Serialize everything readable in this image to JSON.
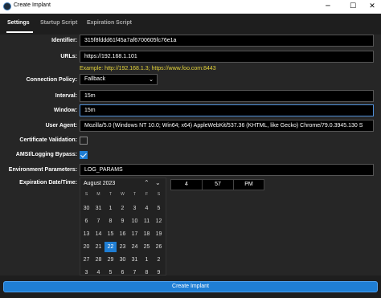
{
  "window": {
    "title": "Create Implant",
    "minimize": "─",
    "maximize": "☐",
    "close": "✕"
  },
  "tabs": [
    "Settings",
    "Startup Script",
    "Expiration Script"
  ],
  "fields": {
    "identifier": {
      "label": "Identifier:",
      "value": "315f8fddd61f45a7af6700605fc76e1a"
    },
    "urls": {
      "label": "URLs:",
      "value": "https://192.168.1.101",
      "hint": "Example: http://192.168.1.3; https://www.foo.com:8443"
    },
    "connection_policy": {
      "label": "Connection Policy:",
      "value": "Fallback"
    },
    "interval": {
      "label": "Interval:",
      "value": "15m"
    },
    "window": {
      "label": "Window:",
      "value": "15m"
    },
    "user_agent": {
      "label": "User Agent:",
      "value": "Mozilla/5.0 (Windows NT 10.0; Win64; x64) AppleWebKit/537.36 (KHTML, like Gecko) Chrome/79.0.3945.130 S"
    },
    "certificate_validation": {
      "label": "Certificate Validation:",
      "checked": false
    },
    "amsi_bypass": {
      "label": "AMSI/Logging Bypass:",
      "checked": true
    },
    "environment_parameters": {
      "label": "Environment Parameters:",
      "value": "LOG_PARAMS"
    },
    "expiration": {
      "label": "Expiration Date/Time:"
    }
  },
  "calendar": {
    "month_label": "August 2023",
    "prev_icon": "chevron-up-icon",
    "next_icon": "chevron-down-icon",
    "weekdays": [
      "S",
      "M",
      "T",
      "W",
      "T",
      "F",
      "S"
    ],
    "weeks": [
      [
        "30",
        "31",
        "1",
        "2",
        "3",
        "4",
        "5"
      ],
      [
        "6",
        "7",
        "8",
        "9",
        "10",
        "11",
        "12"
      ],
      [
        "13",
        "14",
        "15",
        "16",
        "17",
        "18",
        "19"
      ],
      [
        "20",
        "21",
        "22",
        "23",
        "24",
        "25",
        "26"
      ],
      [
        "27",
        "28",
        "29",
        "30",
        "31",
        "1",
        "2"
      ],
      [
        "3",
        "4",
        "5",
        "6",
        "7",
        "8",
        "9"
      ]
    ],
    "selected_day": "22"
  },
  "time": {
    "hour": "4",
    "minute": "57",
    "ampm": "PM"
  },
  "create_button": "Create Implant",
  "colors": {
    "accent": "#1f7ed4",
    "hint": "#e5d43a",
    "background": "#262626"
  }
}
